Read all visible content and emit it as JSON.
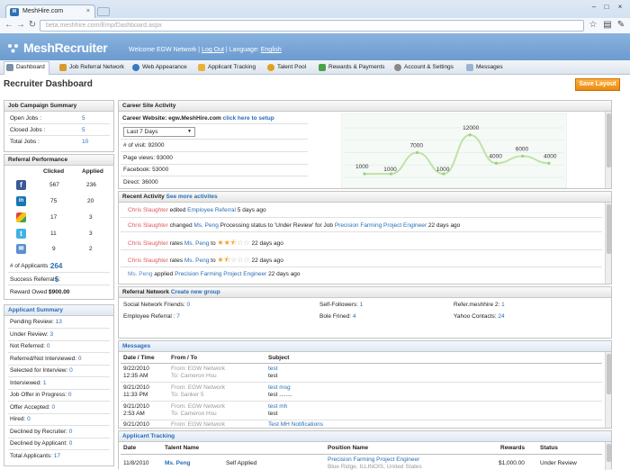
{
  "browser": {
    "tab_title": "MeshHire.com",
    "url": "beta.meshhire.com/Emp/Dashboard.aspx"
  },
  "header": {
    "logo": "MeshRecruiter",
    "welcome": "Welcome EGW Network",
    "logout": "Log Out",
    "language_label": "Language:",
    "language": "English"
  },
  "nav": [
    "Dashboard",
    "Job Referral Network",
    "Web Appearance",
    "Applicant Tracking",
    "Talent Pool",
    "Rewards & Payments",
    "Account & Settings",
    "Messages"
  ],
  "page": {
    "title": "Recruiter Dashboard",
    "save_layout": "Save Layout"
  },
  "job_campaign": {
    "title": "Job Campaign Summary",
    "rows": [
      {
        "label": "Open Jobs :",
        "value": "5"
      },
      {
        "label": "Closed Jobs :",
        "value": "5"
      },
      {
        "label": "Total Jobs :",
        "value": "10"
      }
    ]
  },
  "referral_perf": {
    "title": "Referral Performance",
    "col_clicked": "Clicked",
    "col_applied": "Applied",
    "rows": [
      {
        "icon": "facebook-icon",
        "clicked": "567",
        "applied": "236"
      },
      {
        "icon": "linkedin-icon",
        "clicked": "75",
        "applied": "20"
      },
      {
        "icon": "google-buzz-icon",
        "clicked": "17",
        "applied": "3"
      },
      {
        "icon": "twitter-icon",
        "clicked": "11",
        "applied": "3"
      },
      {
        "icon": "email-icon",
        "clicked": "9",
        "applied": "2"
      }
    ],
    "num_applicants_label": "# of Applicants :",
    "num_applicants": "264",
    "success_label": "Success Referrals :",
    "success": "5",
    "reward_label": "Reward Owed :",
    "reward": "$900.00"
  },
  "applicant_summary": {
    "title": "Applicant Summary",
    "rows": [
      {
        "label": "Pending Review:",
        "value": "13"
      },
      {
        "label": "Under Review:",
        "value": "3"
      },
      {
        "label": "Not Referred:",
        "value": "0"
      },
      {
        "label": "Referred/Not Interviewed:",
        "value": "0"
      },
      {
        "label": "Selected for Interview:",
        "value": "0"
      },
      {
        "label": "Interviewed:",
        "value": "1"
      },
      {
        "label": "Job Offer in Progress:",
        "value": "0"
      },
      {
        "label": "Offer Accepted:",
        "value": "0"
      },
      {
        "label": "Hired:",
        "value": "0"
      },
      {
        "label": "Declined by Recruiter:",
        "value": "0"
      },
      {
        "label": "Declined by Applicant:",
        "value": "0"
      },
      {
        "label": "Total Applicants:",
        "value": "17"
      }
    ]
  },
  "career_site": {
    "title": "Career Site Activity",
    "website_label": "Career Website: egw.MeshHire.com",
    "setup_link": "click here to setup",
    "range": "Last 7 Days",
    "stats": [
      "# of visit: 92000",
      "Page views: 93000",
      "Facebook: 53000",
      "Direct: 36000"
    ]
  },
  "chart_data": {
    "type": "line",
    "x": [
      1,
      2,
      3,
      4,
      5,
      6,
      7
    ],
    "values": [
      1000,
      1000,
      7000,
      1000,
      12000,
      4000,
      6000,
      4000
    ],
    "labels": [
      "1000",
      "1000",
      "7000",
      "1000",
      "12000",
      "4000",
      "6000",
      "4000"
    ],
    "title": "",
    "xlabel": "",
    "ylabel": ""
  },
  "recent_activity": {
    "title": "Recent Activity",
    "more_link": "See more activites",
    "items": [
      {
        "actor": "Chris Slaughter",
        "text1": "edited",
        "link1": "Employee Referral",
        "text2": "5 days ago"
      },
      {
        "actor": "Chris Slaughter",
        "text1": "changed",
        "link1": "Ms. Peng",
        "text2": "Processing status to 'Under Review' for Job",
        "link2": "Precision Farming Project Engineer",
        "text3": "22 days ago"
      },
      {
        "actor": "Chris Slaughter",
        "text1": "rates",
        "link1": "Ms. Peng",
        "text2": "to",
        "stars": 2.5,
        "text3": "22 days ago"
      },
      {
        "actor": "Chris Slaughter",
        "text1": "rates",
        "link1": "Ms. Peng",
        "text2": "to",
        "stars": 1.5,
        "text3": "22 days ago"
      },
      {
        "actor": "Ms. Peng",
        "text1": "applied",
        "link1": "Precision Farming Project Engineer",
        "text2": "22 days ago"
      }
    ]
  },
  "referral_network": {
    "title": "Referral Network",
    "create_link": "Create new group",
    "cells": [
      {
        "label": "Social Network Friends:",
        "value": "0"
      },
      {
        "label": "Self-Followers:",
        "value": "1"
      },
      {
        "label": "Refer.meshhire 2:",
        "value": "1"
      },
      {
        "label": "Employee Referral :",
        "value": "7"
      },
      {
        "label": "Bole Frined:",
        "value": "4"
      },
      {
        "label": "Yahoo Contacts:",
        "value": "24"
      }
    ]
  },
  "messages": {
    "title": "Messages",
    "headers": [
      "Date / Time",
      "From / To",
      "Subject"
    ],
    "rows": [
      {
        "date": "9/22/2010",
        "time": "12:35 AM",
        "from": "From: EGW Network",
        "to": "To: Cameron Hsu",
        "subject": "test",
        "body": "test"
      },
      {
        "date": "9/21/2010",
        "time": "11:33 PM",
        "from": "From: EGW Network",
        "to": "To: Sanker 5",
        "subject": "test msg",
        "body": "test ........"
      },
      {
        "date": "9/21/2010",
        "time": "2:53 AM",
        "from": "From: EGW Network",
        "to": "To: Cameron Hsu",
        "subject": "test mh",
        "body": "test"
      },
      {
        "date": "9/21/2010",
        "time": "",
        "from": "From: EGW Network",
        "to": "",
        "subject": "Test MH Notifications",
        "body": ""
      }
    ]
  },
  "applicant_tracking": {
    "title": "Applicant Tracking",
    "headers": [
      "Date",
      "Talent Name",
      "Position Name",
      "Rewards",
      "Status"
    ],
    "rows": [
      {
        "date": "11/8/2010",
        "name": "Ms. Peng",
        "source": "Self Applied",
        "position": "Precision Farming Project Engineer",
        "location": "Blue Ridge, ILLINOIS, United States",
        "reward": "$1,000.00",
        "status": "Under Review"
      }
    ]
  }
}
